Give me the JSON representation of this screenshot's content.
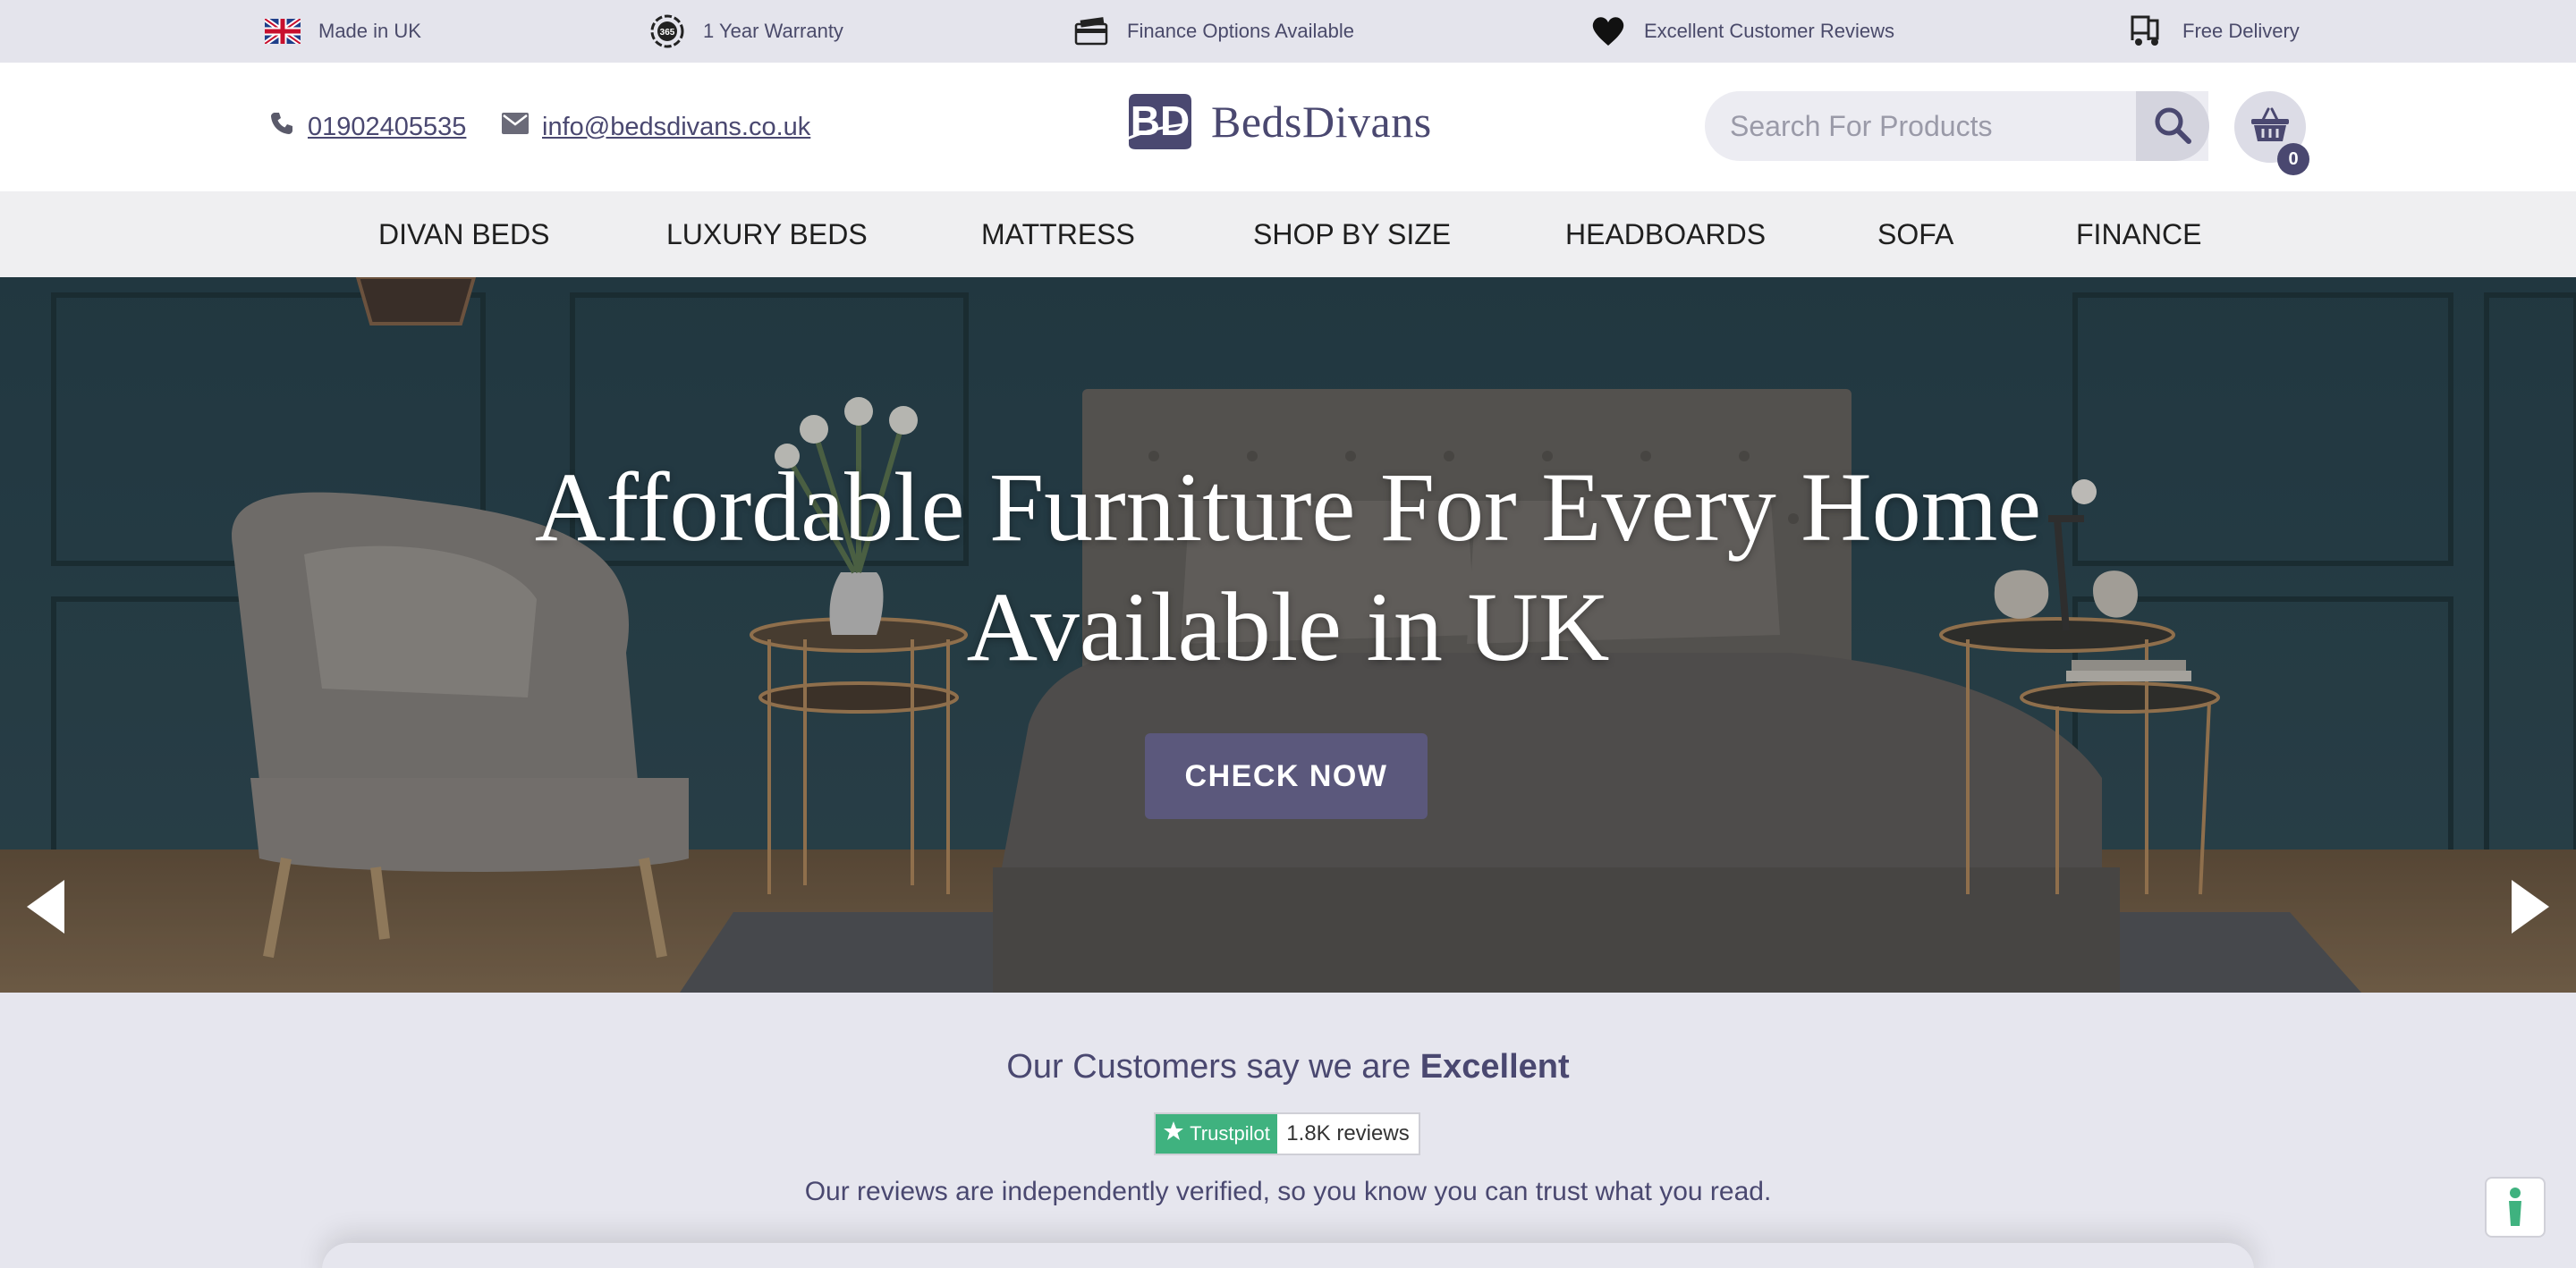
{
  "usp_bar": {
    "items": [
      {
        "icon": "uk-flag-icon",
        "label": "Made in UK"
      },
      {
        "icon": "warranty-badge-icon",
        "label": "1 Year Warranty"
      },
      {
        "icon": "credit-card-icon",
        "label": "Finance Options Available"
      },
      {
        "icon": "heart-icon",
        "label": "Excellent Customer Reviews"
      },
      {
        "icon": "delivery-icon",
        "label": "Free Delivery"
      }
    ]
  },
  "header": {
    "phone": "01902405535",
    "email": "info@bedsdivans.co.uk",
    "logo_text": "BedsDivans",
    "search_placeholder": "Search For Products",
    "cart_count": "0"
  },
  "nav": {
    "items": [
      "DIVAN BEDS",
      "LUXURY BEDS",
      "MATTRESS",
      "SHOP BY SIZE",
      "HEADBOARDS",
      "SOFA",
      "FINANCE"
    ]
  },
  "hero": {
    "title_line1": "Affordable Furniture For Every Home",
    "title_line2": "Available in UK",
    "cta_label": "CHECK NOW"
  },
  "reviews": {
    "heading_prefix": "Our Customers say we are ",
    "heading_emphasis": "Excellent",
    "trustpilot_label": "Trustpilot",
    "trustpilot_count": "1.8K reviews",
    "subtext": "Our reviews are independently verified, so you know you can trust what you read."
  },
  "colors": {
    "brand": "#4a4870",
    "cta": "#5b587c",
    "trustpilot": "#3fb27f",
    "nav_bg": "#efeff1",
    "usp_bg": "#e4e4ec"
  }
}
